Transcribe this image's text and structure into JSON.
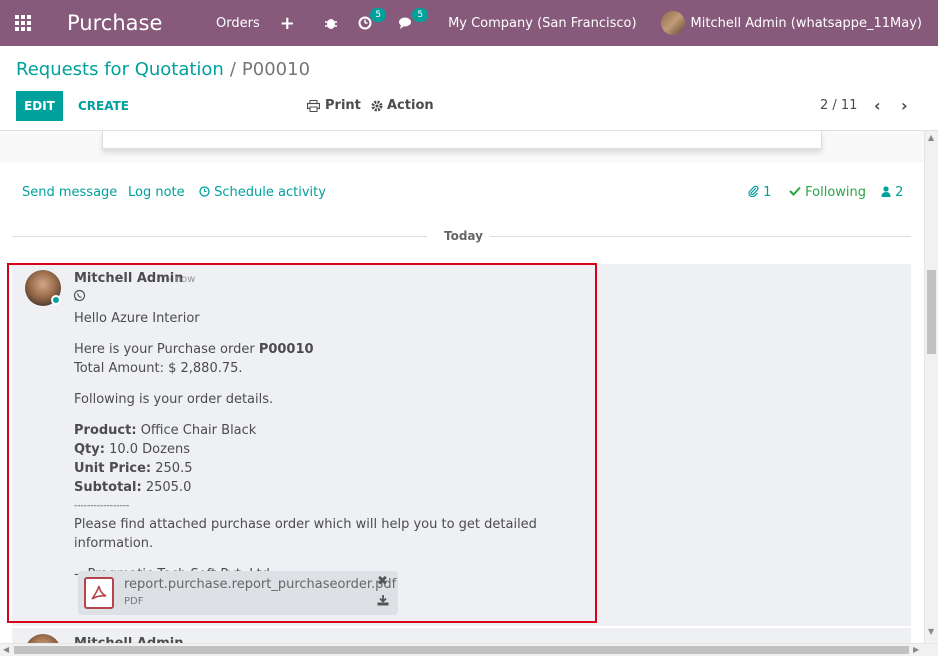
{
  "navbar": {
    "app_name": "Purchase",
    "menu_orders": "Orders",
    "plus_icon": "+",
    "activity_badge": "5",
    "messages_badge": "5",
    "company": "My Company (San Francisco)",
    "user": "Mitchell Admin (whatsappe_11May)",
    "color": "#875a7b"
  },
  "control_panel": {
    "breadcrumb_parent": "Requests for Quotation",
    "breadcrumb_separator": "/",
    "breadcrumb_current": "P00010",
    "edit_label": "EDIT",
    "create_label": "CREATE",
    "print_label": "Print",
    "action_label": "Action",
    "pager": "2 / 11",
    "accent": "#00a09d"
  },
  "chatter": {
    "send_message": "Send message",
    "log_note": "Log note",
    "schedule_activity": "Schedule activity",
    "attachments_count": "1",
    "following": "Following",
    "followers_count": "2",
    "date_separator": "Today"
  },
  "message": {
    "author": "Mitchell Admin",
    "date": "- now",
    "greeting": "Hello Azure Interior",
    "order_intro": "Here is your Purchase order ",
    "order_ref": "P00010",
    "total": "Total Amount: $ 2,880.75.",
    "details_intro": "Following is your order details.",
    "product_label": "Product:",
    "product_value": " Office Chair Black",
    "qty_label": "Qty:",
    "qty_value": " 10.0 Dozens",
    "unit_price_label": "Unit Price:",
    "unit_price_value": " 250.5",
    "subtotal_label": "Subtotal:",
    "subtotal_value": " 2505.0",
    "divider": "-----------------",
    "closing": "Please find attached purchase order which will help you to get detailed information.",
    "signature": "-- Pragmatic Tech Soft Pvt. Ltd.",
    "attachment_name": "report.purchase.report_purchaseorder.pdf",
    "attachment_type": "PDF"
  },
  "next_message": {
    "author": "Mitchell Admin"
  }
}
